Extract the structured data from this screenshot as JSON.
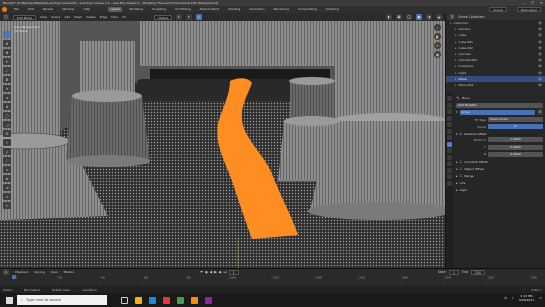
{
  "window": {
    "title": "Blender* [C:\\Blender\\Meshes\\Low Poly Course\\03 - Low Poly Course 2.2 - Low Poly Desert 1 - Modeling The Land Proportional Edit [fixed].blend]",
    "minimize_icon": "minimize-icon",
    "maximize_icon": "maximize-icon",
    "close_icon": "close-icon"
  },
  "menu": {
    "items": [
      "File",
      "Edit",
      "Render",
      "Window",
      "Help"
    ],
    "workspaces": [
      "Layout",
      "Modeling",
      "Sculpting",
      "UV Editing",
      "Texture Paint",
      "Shading",
      "Animation",
      "Rendering",
      "Compositing",
      "Scripting"
    ],
    "active_workspace": "Layout",
    "scene": "Scene",
    "view_layer": "View Layer"
  },
  "viewport_header": {
    "mode": "Edit Mode",
    "menus": [
      "View",
      "Select",
      "Add",
      "Mesh",
      "Vertex",
      "Edge",
      "Face",
      "UV"
    ],
    "orientation": "Global"
  },
  "viewport": {
    "view_name": "User Perspective",
    "object_name": "(1) Plane",
    "accent_orange": "#ff8a1a",
    "wire_color": "#dcdcdc"
  },
  "outliner": {
    "title": "Scene Collection",
    "items": [
      {
        "label": "Collection",
        "selected": false
      },
      {
        "label": "Camera",
        "selected": false
      },
      {
        "label": "Cube",
        "selected": false
      },
      {
        "label": "Cube.001",
        "selected": false
      },
      {
        "label": "Cube.002",
        "selected": false
      },
      {
        "label": "Cylinder",
        "selected": false
      },
      {
        "label": "Cylinder.001",
        "selected": false
      },
      {
        "label": "Icosphere",
        "selected": false
      },
      {
        "label": "Light",
        "selected": false
      },
      {
        "label": "Plane",
        "selected": true
      },
      {
        "label": "Plane.001",
        "selected": false
      }
    ]
  },
  "properties": {
    "object": "Plane",
    "modifier_add": "Add Modifier",
    "modifier_name": "Array",
    "fit_type_label": "Fit Type",
    "fit_type": "Fixed Count",
    "count_label": "Count",
    "count": "8",
    "relative_offset": "Relative Offset",
    "factor_x_label": "Factor X",
    "factor_x": "1.0000",
    "y_label": "Y",
    "y": "0.0000",
    "z_label": "Z",
    "z": "0.0000",
    "sections": [
      "Constant Offset",
      "Object Offset",
      "Merge",
      "UVs",
      "Caps"
    ]
  },
  "timeline": {
    "menus": [
      "Playback",
      "Keying",
      "View",
      "Marker"
    ],
    "current_frame": "1",
    "start_label": "Start",
    "start": "1",
    "end_label": "End",
    "end": "250",
    "ticks": [
      "0",
      "20",
      "40",
      "60",
      "80",
      "100",
      "120",
      "140",
      "160",
      "180",
      "200",
      "220",
      "240"
    ]
  },
  "status_bar": {
    "select": "Select",
    "box_select": "Box Select",
    "rotate": "Rotate View",
    "menu": "Call Menu",
    "version": "2.90.1"
  },
  "taskbar": {
    "search_placeholder": "Type here to search",
    "time": "2:43 PM",
    "date": "3/28/2021"
  }
}
